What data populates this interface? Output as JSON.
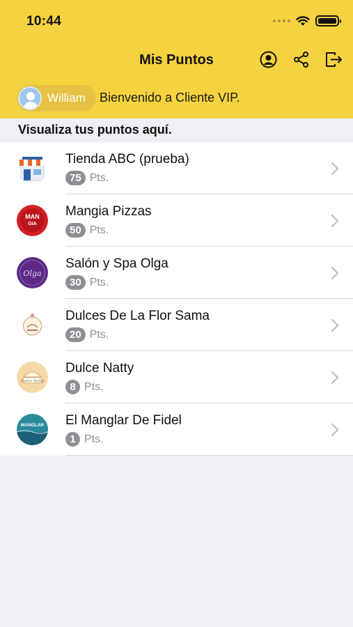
{
  "status_bar": {
    "time": "10:44"
  },
  "nav": {
    "title": "Mis Puntos"
  },
  "user": {
    "name": "William",
    "welcome": "Bienvenido a Cliente VIP."
  },
  "section": {
    "title": "Visualiza tus puntos aquí."
  },
  "stores": [
    {
      "name": "Tienda ABC (prueba)",
      "points": "75",
      "unit": "Pts.",
      "logo": "store-awning-icon"
    },
    {
      "name": "Mangia Pizzas",
      "points": "50",
      "unit": "Pts.",
      "logo": "mangia-logo",
      "logo_text": "MAN GIA"
    },
    {
      "name": "Salón y Spa Olga",
      "points": "30",
      "unit": "Pts.",
      "logo": "spa-olga-logo",
      "logo_text": "Olga"
    },
    {
      "name": "Dulces De La Flor Sama",
      "points": "20",
      "unit": "Pts.",
      "logo": "dulces-flor-logo"
    },
    {
      "name": "Dulce Natty",
      "points": "8",
      "unit": "Pts.",
      "logo": "dulce-natty-logo",
      "logo_text": "Dulce Natty"
    },
    {
      "name": "El Manglar De Fidel",
      "points": "1",
      "unit": "Pts.",
      "logo": "manglar-logo",
      "logo_text": "MANGLAR"
    }
  ],
  "colors": {
    "header": "#f5d23f",
    "badge": "#8e8e93",
    "background": "#efeff4"
  }
}
